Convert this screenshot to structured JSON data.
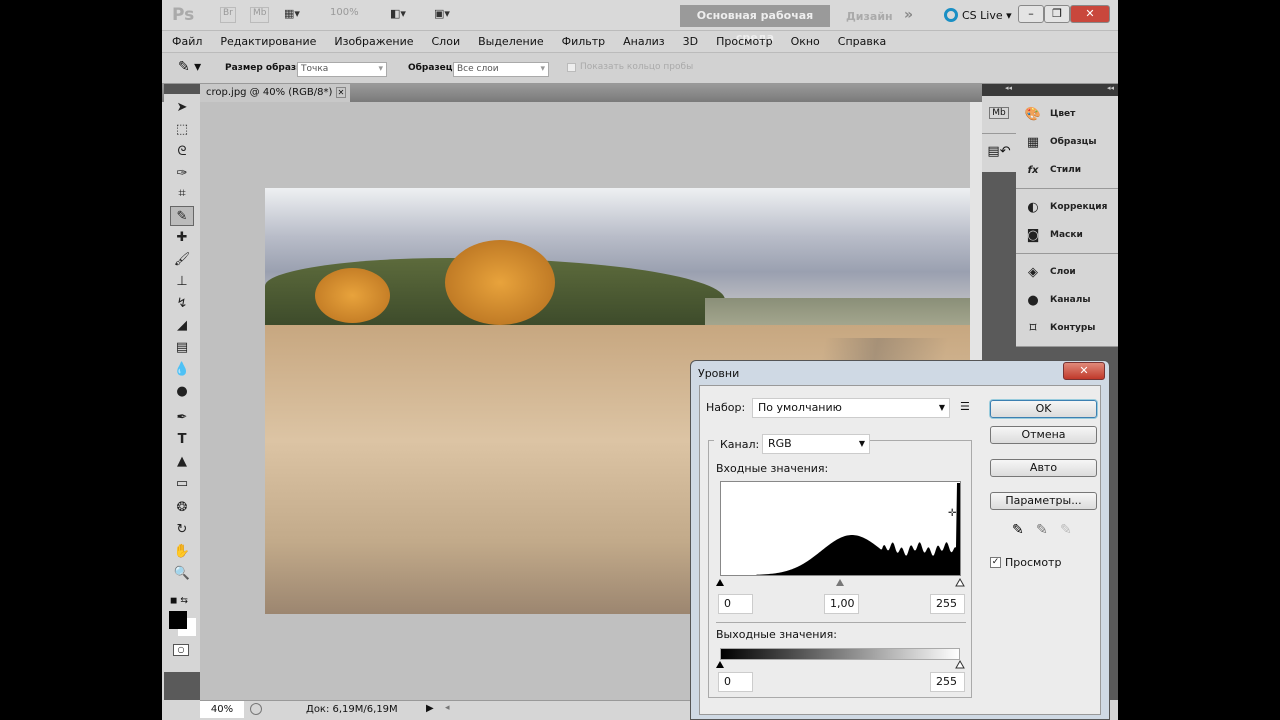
{
  "app": {
    "logo": "Ps",
    "bridge": "Br",
    "minibridge": "Mb",
    "zoom": "100%",
    "workspace": "Основная рабочая среда",
    "design": "Дизайн",
    "more": "»",
    "cslive": "CS Live"
  },
  "menu": [
    "Файл",
    "Редактирование",
    "Изображение",
    "Слои",
    "Выделение",
    "Фильтр",
    "Анализ",
    "3D",
    "Просмотр",
    "Окно",
    "Справка"
  ],
  "options": {
    "sample_size_label": "Размер образца:",
    "sample_size_value": "Точка",
    "sample_label": "Образец:",
    "sample_value": "Все слои",
    "ring_label": "Показать кольцо пробы"
  },
  "document": {
    "tab": "crop.jpg @ 40% (RGB/8*)",
    "zoom": "40%",
    "doc_info": "Док: 6,19M/6,19M"
  },
  "panels": {
    "group1": [
      "Цвет",
      "Образцы",
      "Стили"
    ],
    "group2": [
      "Коррекция",
      "Маски"
    ],
    "group3": [
      "Слои",
      "Каналы",
      "Контуры"
    ]
  },
  "levels": {
    "title": "Уровни",
    "preset_label": "Набор:",
    "preset_value": "По умолчанию",
    "channel_label": "Канал:",
    "channel_value": "RGB",
    "input_label": "Входные значения:",
    "input_black": "0",
    "input_gamma": "1,00",
    "input_white": "255",
    "output_label": "Выходные значения:",
    "output_black": "0",
    "output_white": "255",
    "ok": "OK",
    "cancel": "Отмена",
    "auto": "Авто",
    "options": "Параметры...",
    "preview_label": "Просмотр",
    "preview_checked": true
  }
}
